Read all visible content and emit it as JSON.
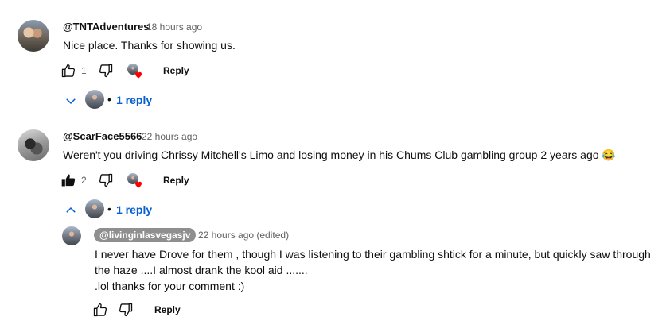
{
  "comments": [
    {
      "handle": "@TNTAdventures",
      "time": "18 hours ago",
      "text": "Nice place. Thanks for showing us.",
      "likes": "1",
      "reply_label": "Reply",
      "replies_label": "1 reply",
      "liked": false
    },
    {
      "handle": "@ScarFace5566",
      "time": "22 hours ago",
      "text": "Weren't you driving Chrissy Mitchell's Limo and losing money in his Chums Club gambling group 2 years ago",
      "emoji": "😂",
      "likes": "2",
      "reply_label": "Reply",
      "replies_label": "1 reply",
      "liked": true,
      "reply": {
        "handle": "@livinginlasvegasjv",
        "time": "22 hours ago (edited)",
        "lines": [
          "I never have Drove for them , though I was listening to their gambling shtick for a minute, but quickly saw through",
          "the haze ....I almost drank the kool aid .......",
          ".lol thanks for your comment :)"
        ],
        "reply_label": "Reply"
      }
    }
  ],
  "separator": "•",
  "colors": {
    "link": "#065fd4",
    "heart": "#ff0000",
    "muted": "#606060"
  },
  "icons": [
    "thumbs-up-icon",
    "thumbs-down-icon",
    "creator-heart-icon",
    "chevron-down-icon",
    "chevron-up-icon"
  ]
}
